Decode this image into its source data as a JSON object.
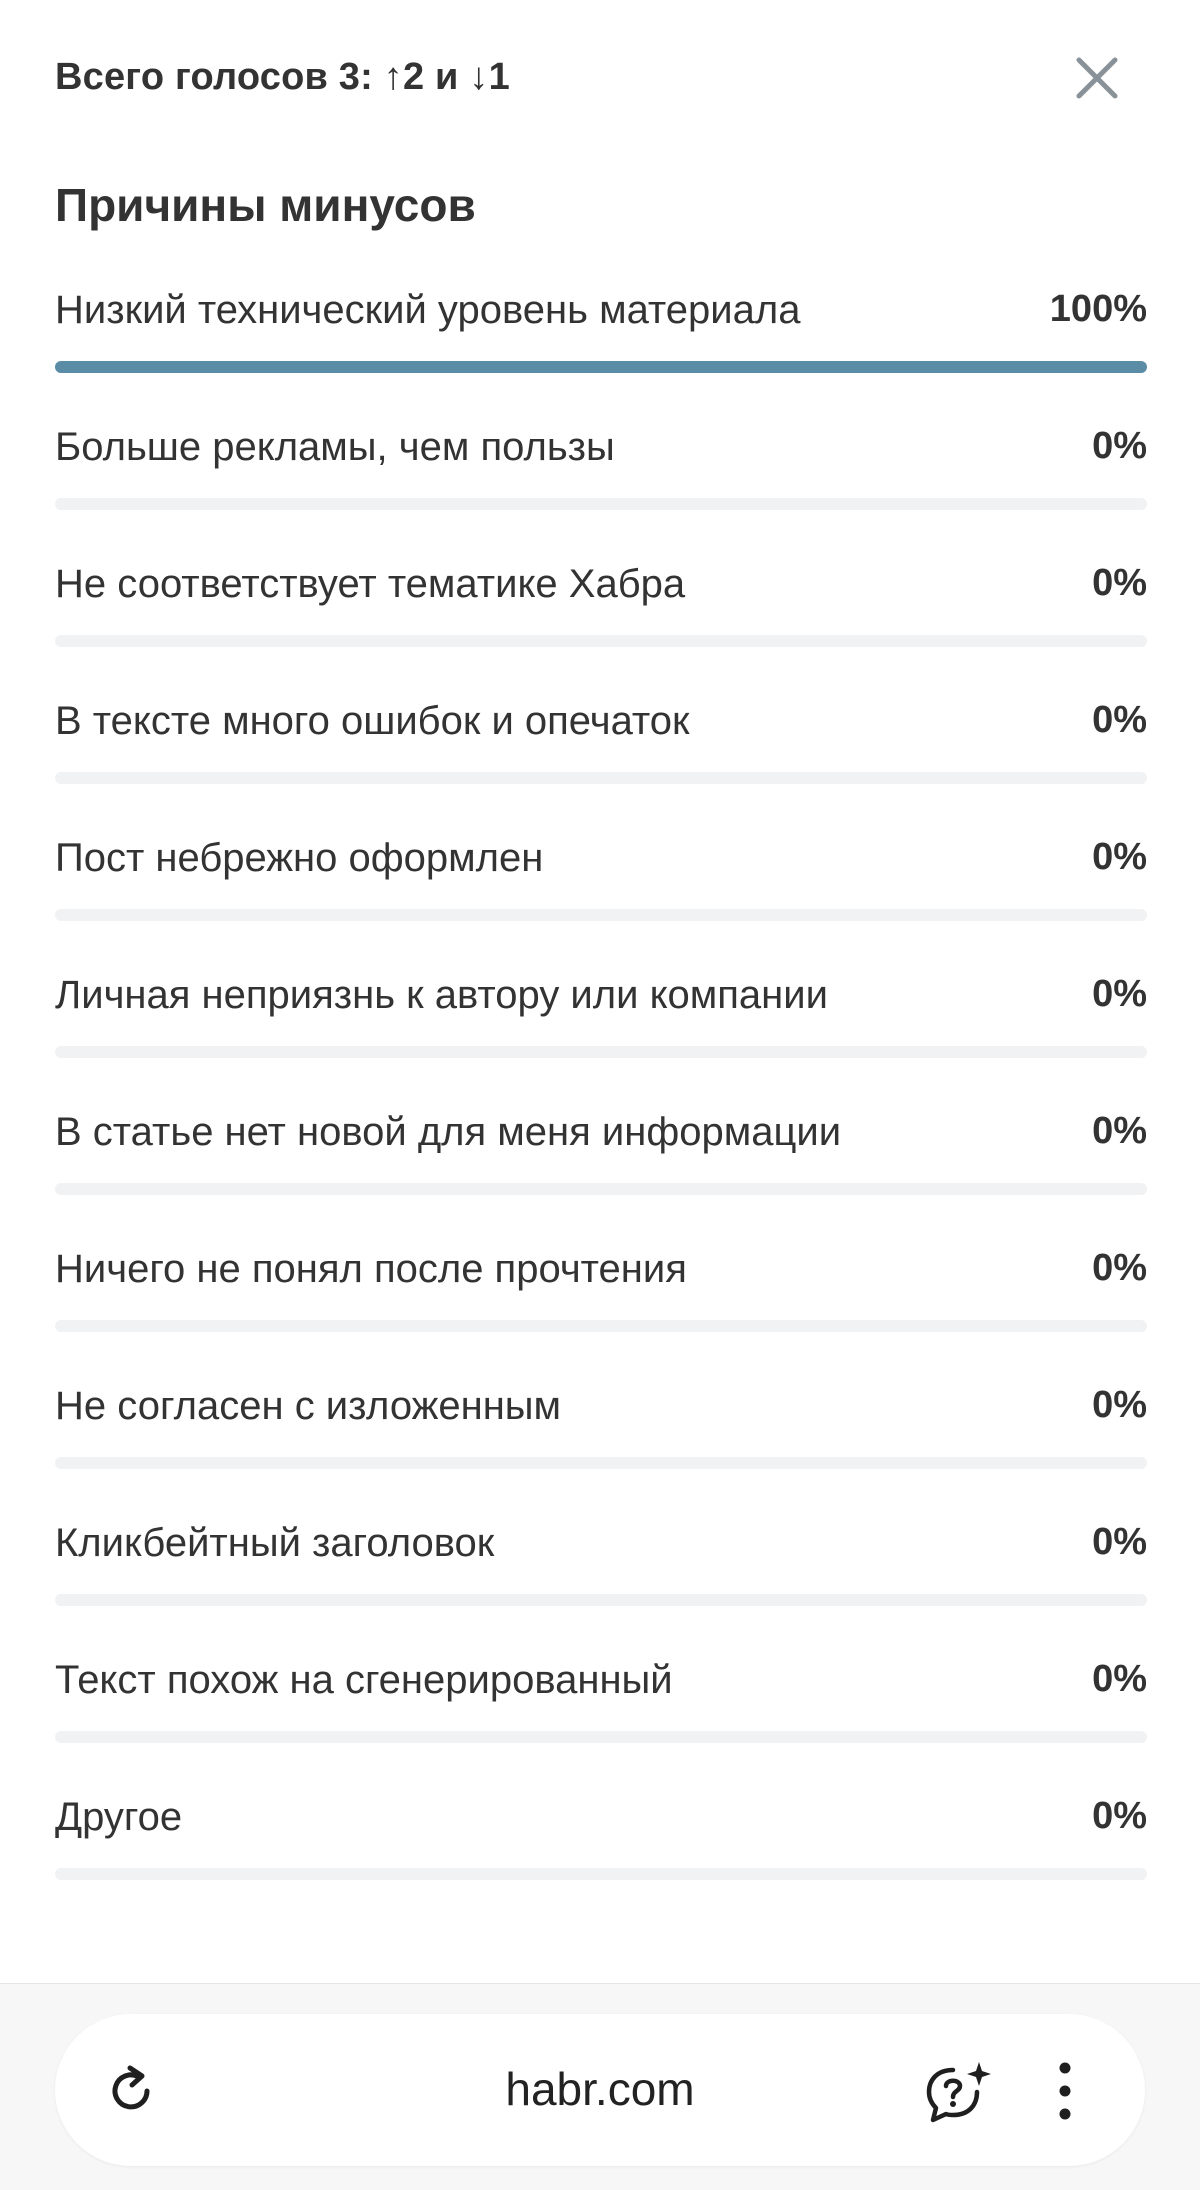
{
  "header": {
    "votes_total": "Всего голосов 3: ↑2 и ↓1"
  },
  "section_title": "Причины минусов",
  "reasons": [
    {
      "label": "Низкий технический уровень материала",
      "percent_text": "100%",
      "fill": 1.0
    },
    {
      "label": "Больше рекламы, чем пользы",
      "percent_text": "0%",
      "fill": 0
    },
    {
      "label": "Не соответствует тематике Хабра",
      "percent_text": "0%",
      "fill": 0
    },
    {
      "label": "В тексте много ошибок и опечаток",
      "percent_text": "0%",
      "fill": 0
    },
    {
      "label": "Пост небрежно оформлен",
      "percent_text": "0%",
      "fill": 0
    },
    {
      "label": "Личная неприязнь к автору или компании",
      "percent_text": "0%",
      "fill": 0
    },
    {
      "label": "В статье нет новой для меня информации",
      "percent_text": "0%",
      "fill": 0
    },
    {
      "label": "Ничего не понял после прочтения",
      "percent_text": "0%",
      "fill": 0
    },
    {
      "label": "Не согласен с изложенным",
      "percent_text": "0%",
      "fill": 0
    },
    {
      "label": "Кликбейтный заголовок",
      "percent_text": "0%",
      "fill": 0
    },
    {
      "label": "Текст похож на сгенерированный",
      "percent_text": "0%",
      "fill": 0
    },
    {
      "label": "Другое",
      "percent_text": "0%",
      "fill": 0
    }
  ],
  "browser": {
    "url": "habr.com"
  },
  "icons": {
    "close": "close-icon",
    "reload": "reload-icon",
    "assistant": "chat-question-sparkle-icon",
    "menu": "more-vertical-icon"
  },
  "colors": {
    "bar_fill": "#5a8ca6",
    "bar_track": "#f0f2f4",
    "text": "#333333"
  }
}
